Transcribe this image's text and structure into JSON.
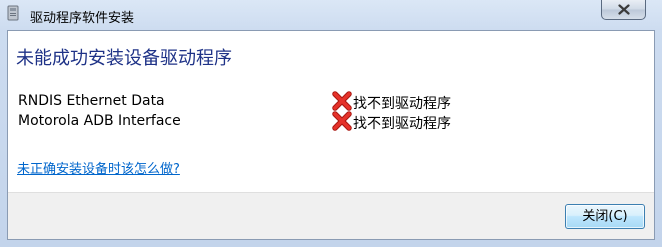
{
  "window": {
    "title": "驱动程序软件安装"
  },
  "heading": "未能成功安装设备驱动程序",
  "devices": [
    {
      "name": "RNDIS Ethernet Data",
      "status": "找不到驱动程序",
      "status_icon": "red-x-icon"
    },
    {
      "name": "Motorola ADB Interface",
      "status": "找不到驱动程序",
      "status_icon": "red-x-icon"
    }
  ],
  "help_link": "未正确安装设备时该怎么做?",
  "buttons": {
    "close": "关闭(C)"
  },
  "colors": {
    "heading": "#1e3287",
    "link": "#0066cc",
    "error": "#d9231c"
  }
}
